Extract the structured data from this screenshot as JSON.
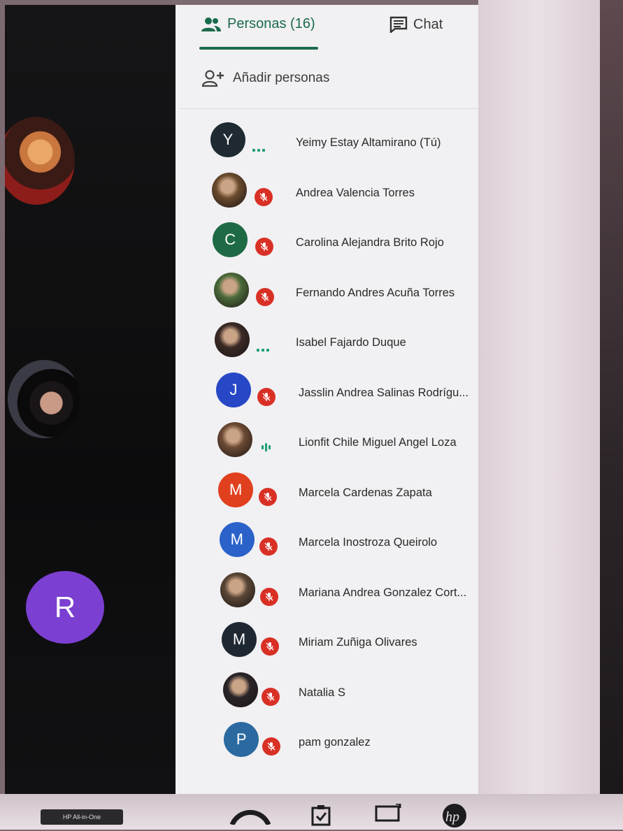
{
  "tabs": {
    "people_label": "Personas (16)",
    "chat_label": "Chat"
  },
  "add_people_label": "Añadir personas",
  "video_strip": {
    "initial_r": "R"
  },
  "participants": [
    {
      "name": "Yeimy Estay Altamirano (Tú)",
      "initial": "Y",
      "avatar_color": "#1f2a33",
      "status": "talking-dots"
    },
    {
      "name": "Andrea Valencia Torres",
      "initial": "",
      "avatar_color": "#6b4b2e",
      "status": "muted"
    },
    {
      "name": "Carolina Alejandra Brito Rojo",
      "initial": "C",
      "avatar_color": "#1e6a44",
      "status": "muted"
    },
    {
      "name": "Fernando Andres Acuña Torres",
      "initial": "",
      "avatar_color": "#4c6b3b",
      "status": "muted"
    },
    {
      "name": "Isabel Fajardo Duque",
      "initial": "",
      "avatar_color": "#3a2a26",
      "status": "talking-dots"
    },
    {
      "name": "Jasslin Andrea Salinas Rodrígu...",
      "initial": "J",
      "avatar_color": "#2747c7",
      "status": "muted"
    },
    {
      "name": "Lionfit Chile Miguel Angel Loza",
      "initial": "",
      "avatar_color": "#6c4a34",
      "status": "speaking"
    },
    {
      "name": "Marcela Cardenas Zapata",
      "initial": "M",
      "avatar_color": "#e0401e",
      "status": "muted"
    },
    {
      "name": "Marcela Inostroza Queirolo",
      "initial": "M",
      "avatar_color": "#2a62c9",
      "status": "muted"
    },
    {
      "name": "Mariana Andrea Gonzalez Cort...",
      "initial": "",
      "avatar_color": "#5a4636",
      "status": "muted"
    },
    {
      "name": "Miriam Zuñiga Olivares",
      "initial": "M",
      "avatar_color": "#1e2833",
      "status": "muted"
    },
    {
      "name": "Natalia S",
      "initial": "",
      "avatar_color": "#2a2528",
      "status": "muted"
    },
    {
      "name": "pam gonzalez",
      "initial": "P",
      "avatar_color": "#2b6aa0",
      "status": "muted"
    }
  ],
  "taskbar_label": "HP All-in-One",
  "colors": {
    "accent": "#1a6b4c",
    "muted_red": "#d93025",
    "speaking_green": "#1e9e76"
  }
}
